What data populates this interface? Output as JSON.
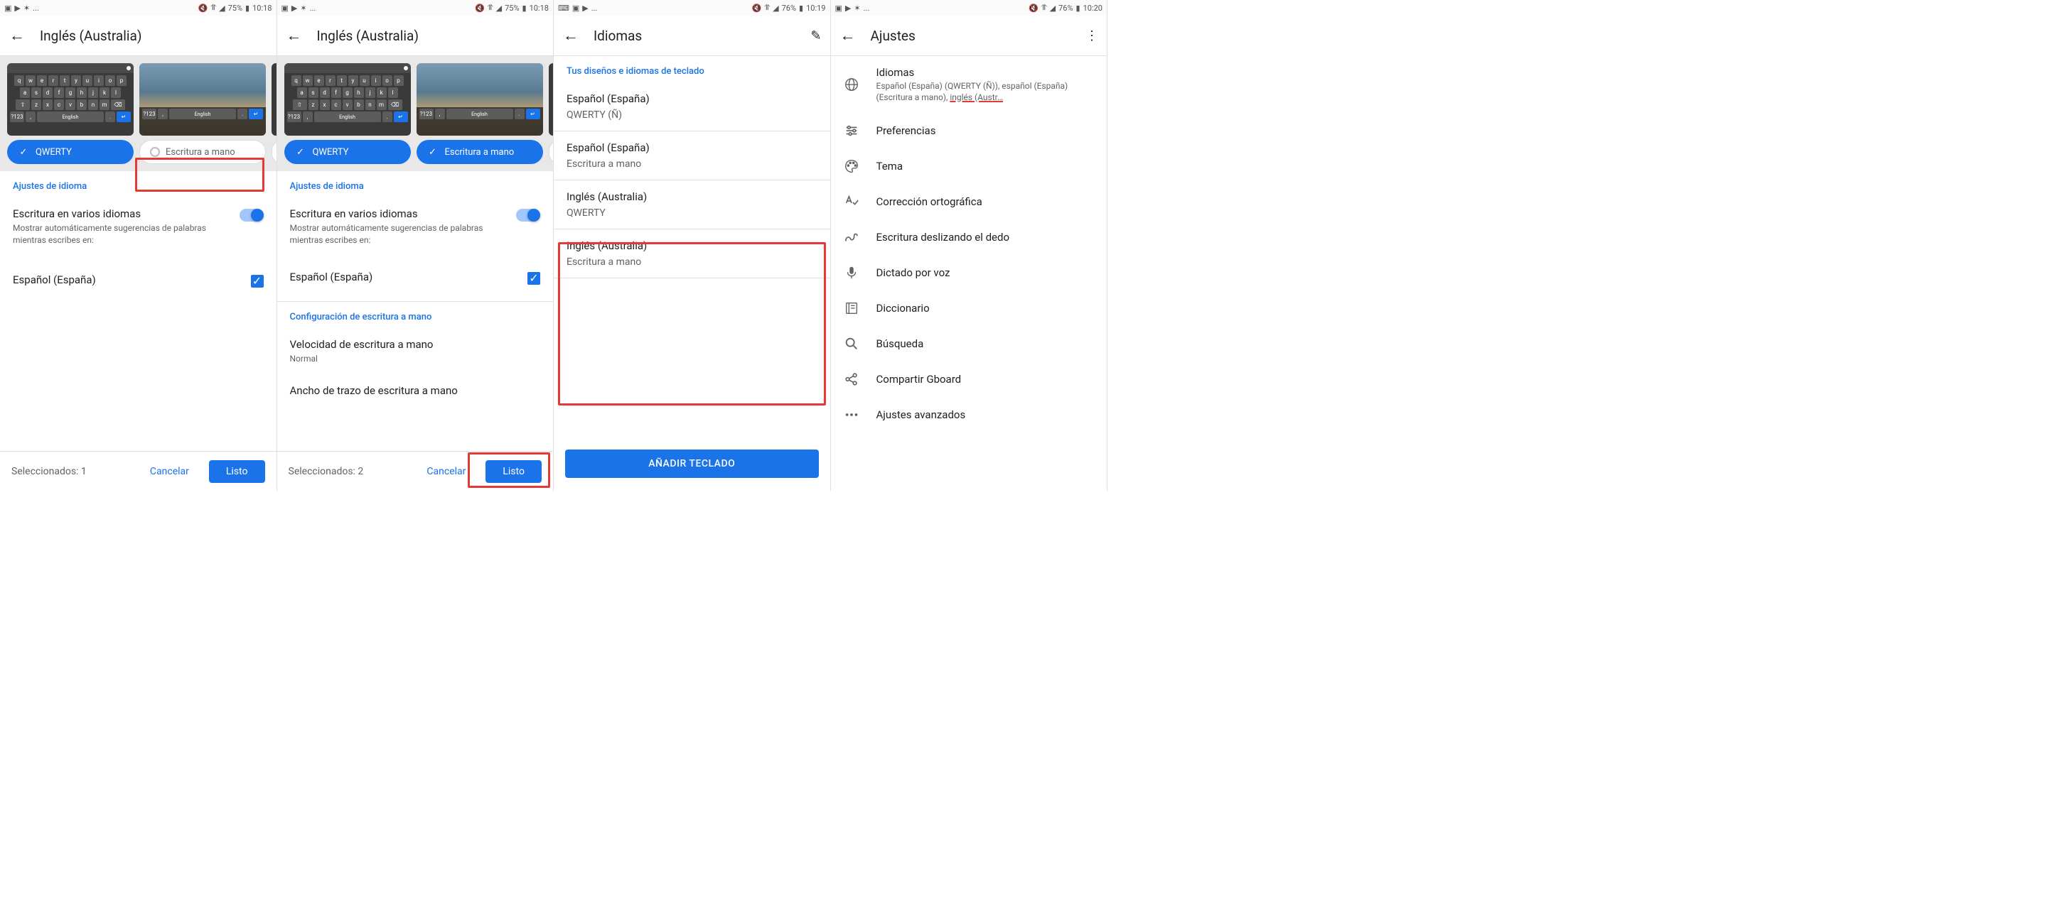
{
  "status": {
    "left_dots": "...",
    "battery_a": "75%",
    "time_a": "10:18",
    "battery_b": "76%",
    "time_b": "10:19",
    "time_c": "10:20"
  },
  "p1": {
    "title": "Inglés (Australia)",
    "chip_qwerty": "QWERTY",
    "chip_hand": "Escritura a mano",
    "sec_lang": "Ajustes de idioma",
    "multi_title": "Escritura en varios idiomas",
    "multi_sub": "Mostrar automáticamente sugerencias de palabras mientras escribes en:",
    "spanish": "Español (España)",
    "selected": "Seleccionados: 1",
    "cancel": "Cancelar",
    "done": "Listo",
    "kb_space": "English"
  },
  "p2": {
    "title": "Inglés (Australia)",
    "chip_qwerty": "QWERTY",
    "chip_hand": "Escritura a mano",
    "sec_lang": "Ajustes de idioma",
    "multi_title": "Escritura en varios idiomas",
    "multi_sub": "Mostrar automáticamente sugerencias de palabras mientras escribes en:",
    "spanish": "Español (España)",
    "sec_hand": "Configuración de escritura a mano",
    "speed_title": "Velocidad de escritura a mano",
    "speed_val": "Normal",
    "stroke_title": "Ancho de trazo de escritura a mano",
    "selected": "Seleccionados: 2",
    "cancel": "Cancelar",
    "done": "Listo"
  },
  "p3": {
    "title": "Idiomas",
    "header": "Tus diseños e idiomas de teclado",
    "items": [
      {
        "t": "Español (España)",
        "s": "QWERTY (Ñ)"
      },
      {
        "t": "Español (España)",
        "s": "Escritura a mano"
      },
      {
        "t": "Inglés (Australia)",
        "s": "QWERTY"
      },
      {
        "t": "Inglés (Australia)",
        "s": "Escritura a mano"
      }
    ],
    "add": "AÑADIR TECLADO"
  },
  "p4": {
    "title": "Ajustes",
    "items": [
      {
        "t": "Idiomas",
        "s1": "Español (España) (QWERTY (Ñ)), español (España) (Escritura a mano), ",
        "s2": "inglés (Austr…"
      },
      {
        "t": "Preferencias"
      },
      {
        "t": "Tema"
      },
      {
        "t": "Corrección ortográfica"
      },
      {
        "t": "Escritura deslizando el dedo"
      },
      {
        "t": "Dictado por voz"
      },
      {
        "t": "Diccionario"
      },
      {
        "t": "Búsqueda"
      },
      {
        "t": "Compartir Gboard"
      },
      {
        "t": "Ajustes avanzados"
      }
    ]
  }
}
